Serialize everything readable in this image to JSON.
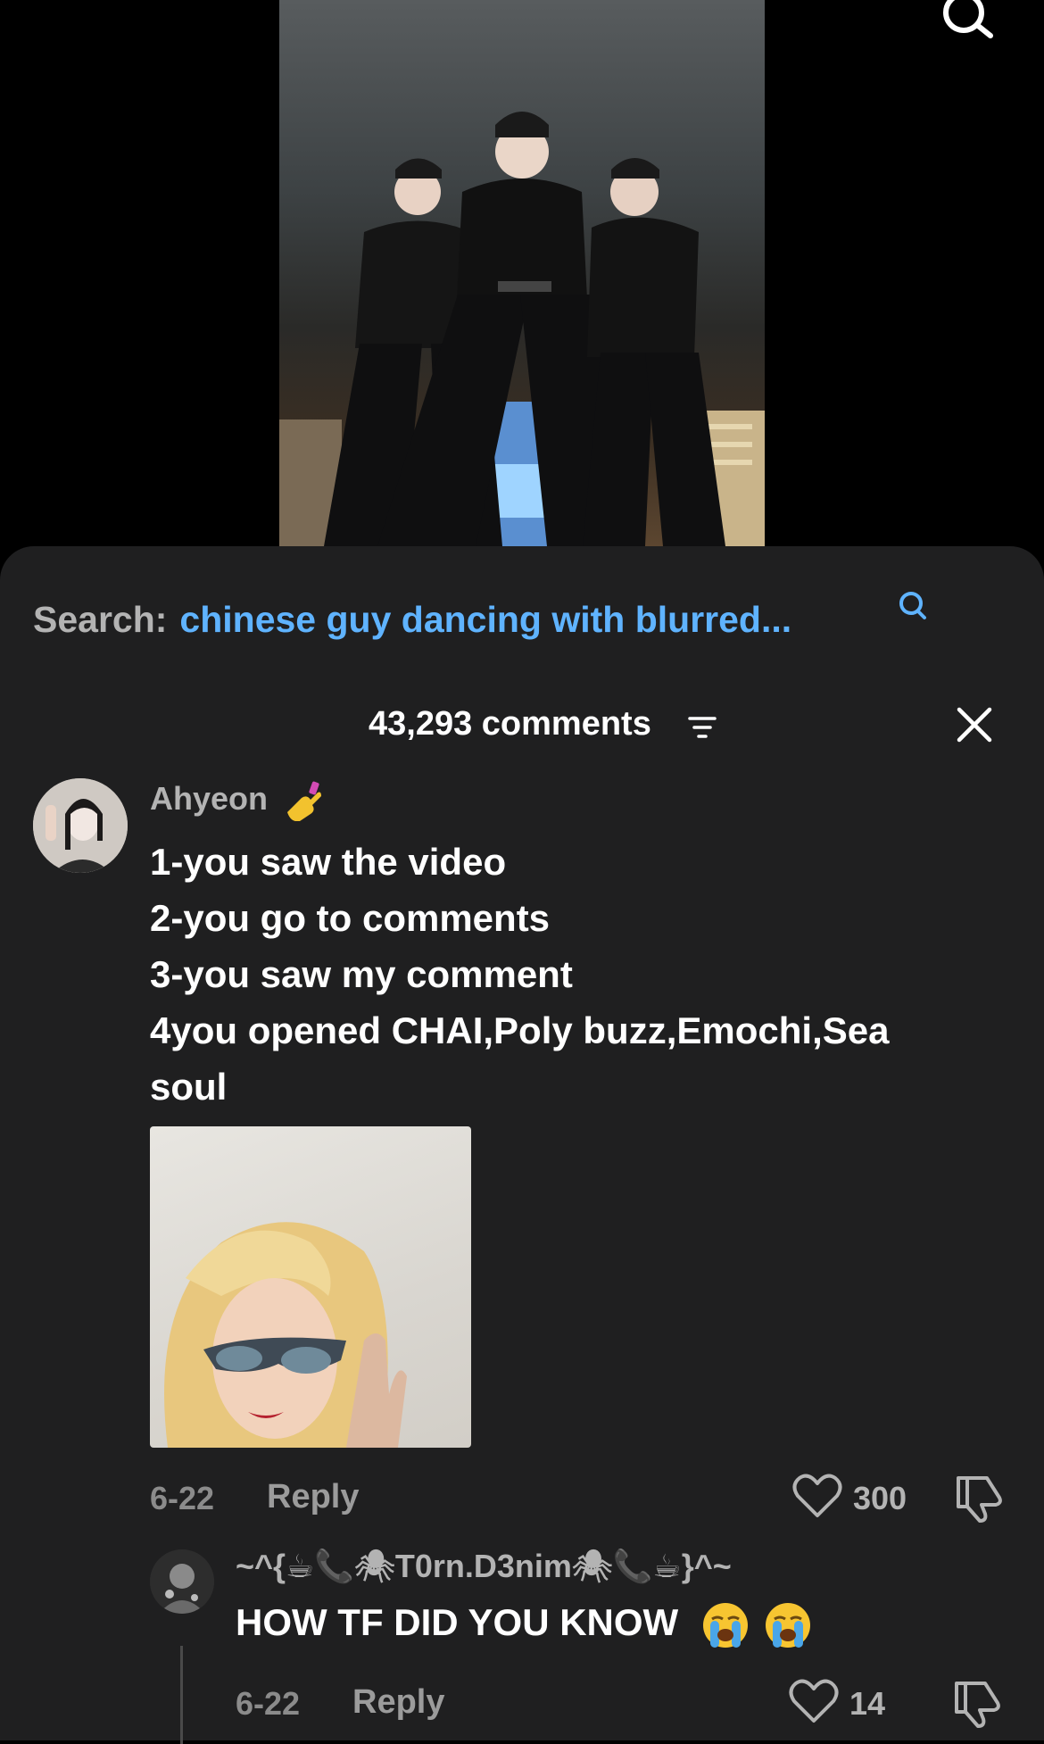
{
  "video": {
    "thumbnail": "video-thumbnail-dancers"
  },
  "top_bar": {
    "search_icon": "search-icon"
  },
  "search_suggestion": {
    "label": "Search:",
    "query": "chinese guy dancing with blurred...",
    "icon": "search-icon",
    "color_query": "#5fb3ff"
  },
  "comments_header": {
    "count_label": "43,293 comments",
    "sort_icon": "sort-icon",
    "close_icon": "close-icon"
  },
  "comments": [
    {
      "username": "Ahyeon",
      "username_emoji": "nail-polish-emoji",
      "lines": [
        "1-you saw the video",
        "2-you go to comments",
        "3-you saw my comment",
        "4you opened CHAI,Poly buzz,Emochi,Sea",
        "soul"
      ],
      "photo": "doll-with-sunglasses-photo",
      "date": "6-22",
      "reply_label": "Reply",
      "likes": "300"
    }
  ],
  "replies": [
    {
      "username": "~^{☕📞🕷T0rn.D3nim🕷📞☕}^~",
      "text": "HOW TF DID YOU KNOW",
      "text_emoji": [
        "loudly-crying-face-emoji",
        "loudly-crying-face-emoji"
      ],
      "date": "6-22",
      "reply_label": "Reply",
      "likes": "14"
    }
  ]
}
